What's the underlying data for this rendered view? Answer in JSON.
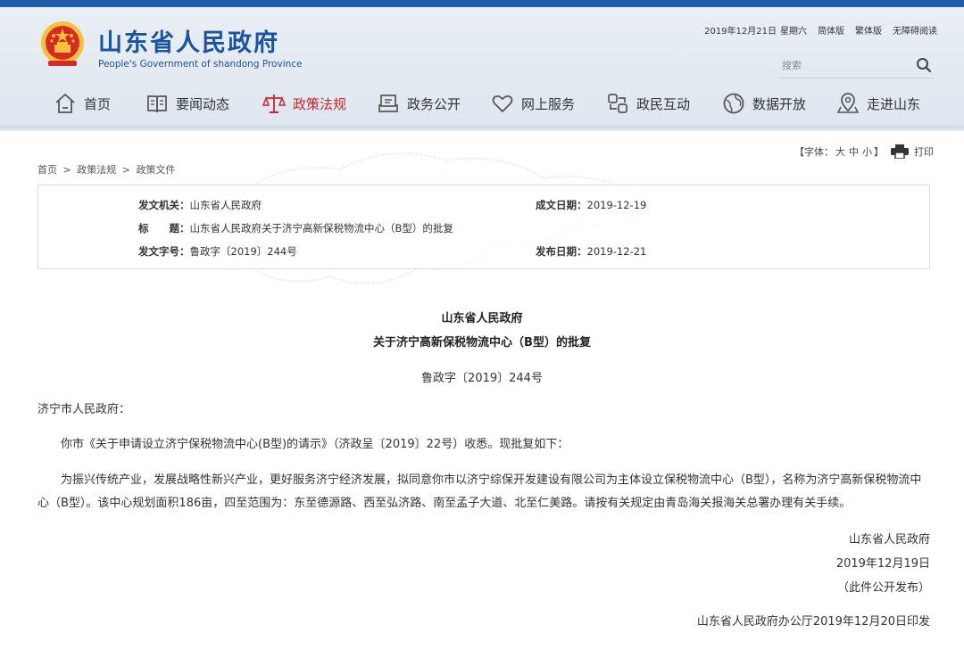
{
  "header": {
    "site_title": "山东省人民政府",
    "site_subtitle": "People's Government of shandong Province",
    "date": "2019年12月21日",
    "weekday": "星期六",
    "links": [
      "简体版",
      "繁体版",
      "无障碍阅读"
    ],
    "search_placeholder": "搜索"
  },
  "nav": {
    "items": [
      {
        "label": "首页",
        "icon": "home-icon"
      },
      {
        "label": "要闻动态",
        "icon": "book-icon"
      },
      {
        "label": "政策法规",
        "icon": "scale-icon"
      },
      {
        "label": "政务公开",
        "icon": "tray-icon"
      },
      {
        "label": "网上服务",
        "icon": "heart-icon"
      },
      {
        "label": "政民互动",
        "icon": "link-icon"
      },
      {
        "label": "数据开放",
        "icon": "globe-icon"
      },
      {
        "label": "走进山东",
        "icon": "map-pin-icon"
      }
    ],
    "active": "政策法规"
  },
  "breadcrumb": [
    "首页",
    "政策法规",
    "政策文件"
  ],
  "breadcrumb_sep": ">",
  "tools": {
    "font_label_open": "【字体：",
    "sizes": [
      "大",
      "中",
      "小"
    ],
    "font_label_close": "】",
    "print": "打印"
  },
  "meta": {
    "issuer_key": "发文机关：",
    "issuer": "山东省人民政府",
    "date_written_key": "成文日期：",
    "date_written": "2019-12-19",
    "title_key": "标　　题：",
    "title": "山东省人民政府关于济宁高新保税物流中心（B型）的批复",
    "doc_no_key": "发文字号：",
    "doc_no": "鲁政字〔2019〕244号",
    "published_key": "发布日期：",
    "published": "2019-12-21"
  },
  "document": {
    "issuer": "山东省人民政府",
    "title": "关于济宁高新保税物流中心（B型）的批复",
    "number": "鲁政字〔2019〕244号",
    "recipient": "济宁市人民政府：",
    "paragraph1": "你市《关于申请设立济宁保税物流中心(B型)的请示》（济政呈〔2019〕22号）收悉。现批复如下：",
    "paragraph2": "为振兴传统产业，发展战略性新兴产业，更好服务济宁经济发展，拟同意你市以济宁综保开发建设有限公司为主体设立保税物流中心（B型），名称为济宁高新保税物流中心（B型）。该中心规划面积186亩，四至范围为：东至德源路、西至弘济路、南至孟子大道、北至仁美路。请按有关规定由青岛海关报海关总署办理有关手续。",
    "signature": "山东省人民政府",
    "sign_date": "2019年12月19日",
    "disclosure": "（此件公开发布）",
    "footer": "山东省人民政府办公厅2019年12月20日印发"
  },
  "colors": {
    "brand_blue": "#1a54a0",
    "active_red": "#c8282d",
    "top_strip": "#1e5ea8"
  }
}
